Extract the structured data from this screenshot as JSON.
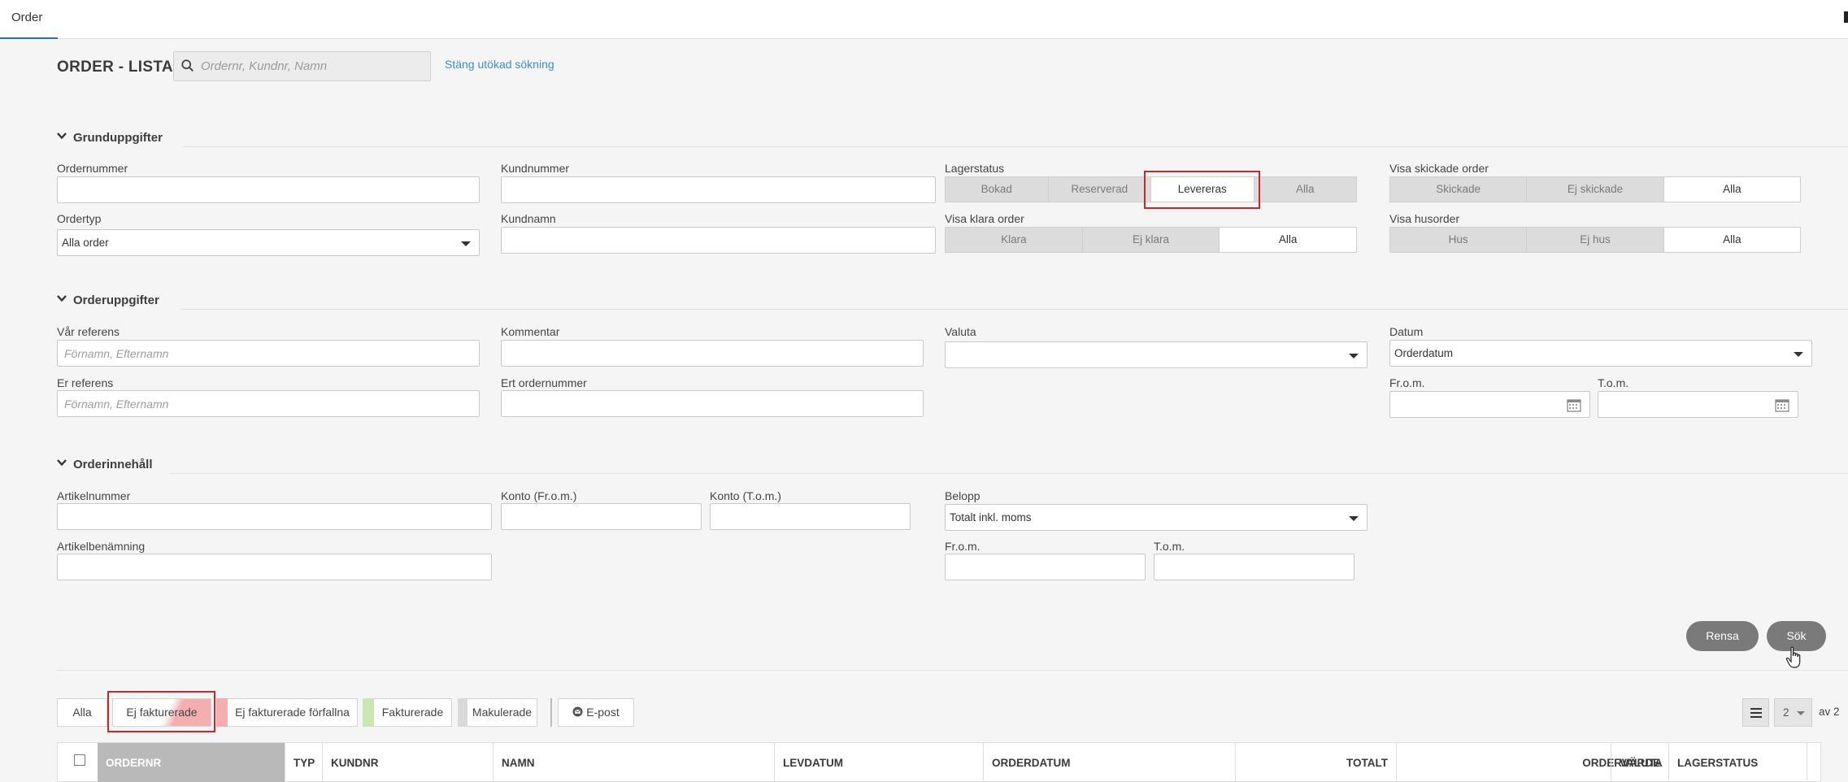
{
  "topbar": {
    "tab_label": "Order"
  },
  "header": {
    "title": "ORDER - LISTA",
    "search_placeholder": "Ordernr, Kundnr, Namn",
    "toggle_link": "Stäng utökad sökning"
  },
  "grunduppgifter": {
    "heading": "Grunduppgifter",
    "ordernummer_label": "Ordernummer",
    "kundnummer_label": "Kundnummer",
    "ordertyp_label": "Ordertyp",
    "ordertyp_value": "Alla order",
    "kundnamn_label": "Kundnamn",
    "lagerstatus_label": "Lagerstatus",
    "lagerstatus_options": [
      "Bokad",
      "Reserverad",
      "Levereras",
      "Alla"
    ],
    "lagerstatus_selected": "Levereras",
    "visa_klara_label": "Visa klara order",
    "visa_klara_options": [
      "Klara",
      "Ej klara",
      "Alla"
    ],
    "visa_klara_selected": "Alla",
    "visa_skickade_label": "Visa skickade order",
    "visa_skickade_options": [
      "Skickade",
      "Ej skickade",
      "Alla"
    ],
    "visa_skickade_selected": "Alla",
    "visa_hus_label": "Visa husorder",
    "visa_hus_options": [
      "Hus",
      "Ej hus",
      "Alla"
    ],
    "visa_hus_selected": "Alla"
  },
  "orderuppgifter": {
    "heading": "Orderuppgifter",
    "var_referens_label": "Vår referens",
    "var_referens_placeholder": "Förnamn, Efternamn",
    "kommentar_label": "Kommentar",
    "valuta_label": "Valuta",
    "valuta_value": "",
    "datum_label": "Datum",
    "datum_value": "Orderdatum",
    "er_referens_label": "Er referens",
    "er_referens_placeholder": "Förnamn, Efternamn",
    "ert_ordernummer_label": "Ert ordernummer",
    "from_label": "Fr.o.m.",
    "tom_label": "T.o.m."
  },
  "orderinnehall": {
    "heading": "Orderinnehåll",
    "artikelnummer_label": "Artikelnummer",
    "konto_from_label": "Konto (Fr.o.m.)",
    "konto_tom_label": "Konto (T.o.m.)",
    "belopp_label": "Belopp",
    "belopp_value": "Totalt inkl. moms",
    "artikelbenamning_label": "Artikelbenämning",
    "from_label": "Fr.o.m.",
    "tom_label": "T.o.m."
  },
  "actions": {
    "clear": "Rensa",
    "search": "Sök"
  },
  "filters": {
    "tabs": [
      "Alla",
      "Ej fakturerade",
      "Ej fakturerade förfallna",
      "Fakturerade",
      "Makulerade"
    ],
    "selected": "Ej fakturerade",
    "email": "E-post"
  },
  "pagination": {
    "page": "2",
    "of_label": "av 2"
  },
  "table": {
    "columns": [
      "ORDERNR",
      "TYP",
      "KUNDNR",
      "NAMN",
      "LEVDATUM",
      "ORDERDATUM",
      "TOTALT",
      "ORDERVÄRDE",
      "VALUTA",
      "LAGERSTATUS"
    ]
  },
  "colors": {
    "accent": "#2f6e9c",
    "link": "#3b8fc8",
    "highlight": "#c9272b",
    "unbilled": "#f4aeb0",
    "billed": "#c9e7b0",
    "cancelled": "#d9d9d9",
    "button": "#7a7a7a"
  }
}
